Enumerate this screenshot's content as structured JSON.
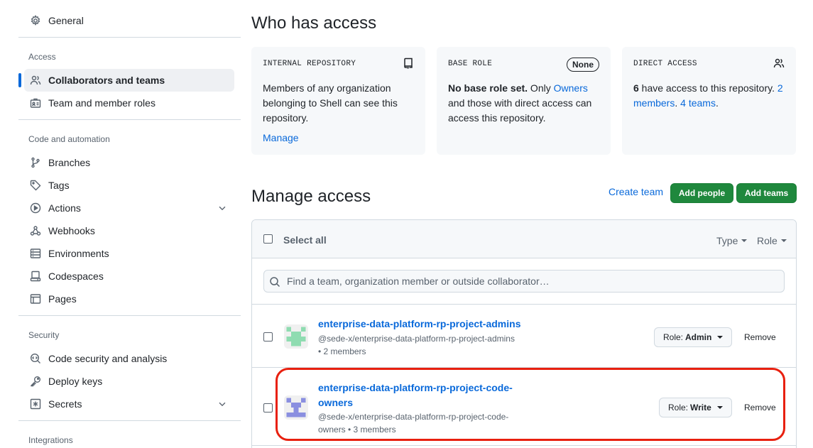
{
  "sidebar": {
    "general": "General",
    "access_section": "Access",
    "access_items": [
      "Collaborators and teams",
      "Team and member roles"
    ],
    "code_section": "Code and automation",
    "code_items": [
      "Branches",
      "Tags",
      "Actions",
      "Webhooks",
      "Environments",
      "Codespaces",
      "Pages"
    ],
    "security_section": "Security",
    "security_items": [
      "Code security and analysis",
      "Deploy keys",
      "Secrets"
    ],
    "integrations_section": "Integrations"
  },
  "main": {
    "title": "Who has access",
    "cards": {
      "internal": {
        "label": "INTERNAL REPOSITORY",
        "text": "Members of any organization belonging to Shell can see this repository.",
        "link": "Manage"
      },
      "base_role": {
        "label": "BASE ROLE",
        "badge": "None",
        "bold": "No base role set.",
        "text_a": " Only ",
        "link": "Owners",
        "text_b": " and those with direct access can access this repository."
      },
      "direct": {
        "label": "DIRECT ACCESS",
        "count": "6",
        "text_a": " have access to this repository. ",
        "link_members": "2 members",
        "dot": ". ",
        "link_teams": "4 teams",
        "end": "."
      }
    },
    "manage": {
      "title": "Manage access",
      "create_team": "Create team",
      "add_people": "Add people",
      "add_teams": "Add teams",
      "select_all": "Select all",
      "type_filter": "Type",
      "role_filter": "Role",
      "search_placeholder": "Find a team, organization member or outside collaborator…",
      "rows": [
        {
          "name": "enterprise-data-platform-rp-project-admins",
          "path": "@sede-x/enterprise-data-platform-rp-project-admins",
          "members": "• 2 members",
          "role_prefix": "Role: ",
          "role": "Admin",
          "remove": "Remove"
        },
        {
          "name_line1": "enterprise-data-platform-rp-project-code-",
          "name_line2": "owners",
          "path_line1": "@sede-x/enterprise-data-platform-rp-project-code-",
          "path_line2": "owners • 3 members",
          "role_prefix": "Role: ",
          "role": "Write",
          "remove": "Remove"
        }
      ]
    }
  },
  "colors": {
    "accent": "#0969da",
    "primary_button": "#1f883d",
    "highlight": "#e8200f"
  }
}
